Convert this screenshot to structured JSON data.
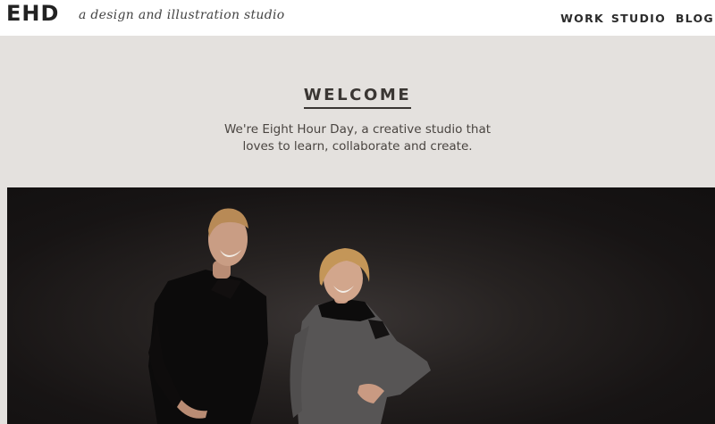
{
  "header": {
    "logo_text": "EHD",
    "tagline": "a design and illustration studio"
  },
  "nav": {
    "items": [
      {
        "label": "WORK"
      },
      {
        "label": "STUDIO"
      },
      {
        "label": "BLOG"
      }
    ]
  },
  "welcome": {
    "title": "WELCOME",
    "line1": "We're Eight Hour Day, a creative studio that",
    "line2": "loves to learn, collaborate and create."
  },
  "colors": {
    "page_background": "#e4e1de",
    "header_background": "#ffffff",
    "text_dark": "#3a3633",
    "photo_background": "#171414"
  }
}
